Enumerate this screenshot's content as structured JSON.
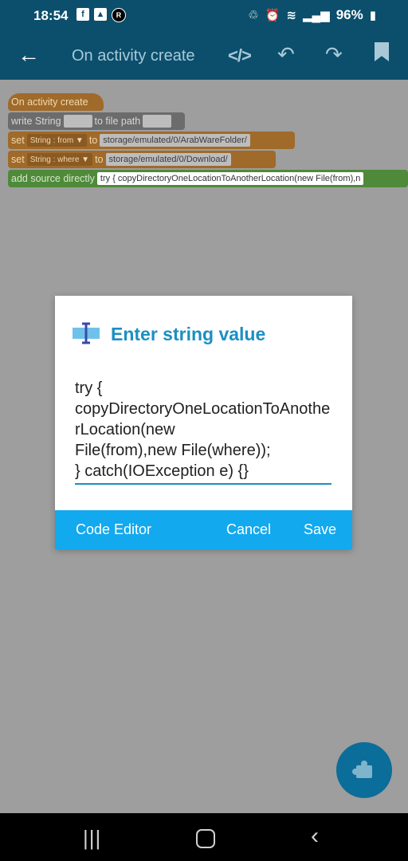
{
  "status_bar": {
    "time": "18:54",
    "battery": "96%",
    "left_icons": [
      "facebook-icon",
      "gallery-icon",
      "app-icon"
    ],
    "right_icons": [
      "battery-saver-icon",
      "alarm-icon",
      "wifi-icon",
      "signal-icon",
      "battery-icon"
    ]
  },
  "app_bar": {
    "title": "On activity create",
    "code_icon": "</>"
  },
  "blocks": {
    "event": "On activity create",
    "write": {
      "label1": "write String",
      "label2": "to file path"
    },
    "set1": {
      "label": "set",
      "var": "String : from",
      "to": "to",
      "value": "storage/emulated/0/ArabWareFolder/"
    },
    "set2": {
      "label": "set",
      "var": "String : where",
      "to": "to",
      "value": "storage/emulated/0/Download/"
    },
    "add": {
      "label": "add source directly",
      "value": "try { copyDirectoryOneLocationToAnotherLocation(new File(from),n"
    }
  },
  "dialog": {
    "title": "Enter string value",
    "value": "try {\ncopyDirectoryOneLocationToAnotherLocation(new\nFile(from),new File(where));\n} catch(IOException e) {}",
    "actions": {
      "code_editor": "Code Editor",
      "cancel": "Cancel",
      "save": "Save"
    }
  },
  "colors": {
    "primary": "#0b4f6c",
    "accent": "#12a9ee",
    "title_blue": "#1b8fc2"
  }
}
